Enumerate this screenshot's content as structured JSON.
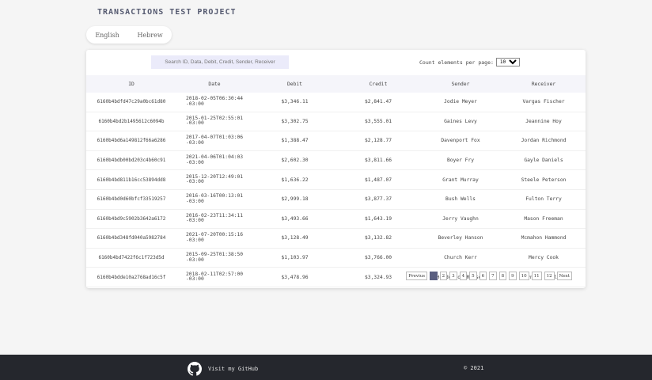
{
  "app": {
    "title": "TRANSACTIONS TEST PROJECT"
  },
  "languages": [
    {
      "label": "English",
      "active": true
    },
    {
      "label": "Hebrew",
      "active": false
    }
  ],
  "controls": {
    "search_placeholder": "Search ID, Data, Debit, Credit, Sender, Receiver",
    "count_label": "Count elements per page:",
    "count_value": "10"
  },
  "table": {
    "headers": [
      "ID",
      "Date",
      "Debit",
      "Credit",
      "Sender",
      "Receiver"
    ],
    "rows": [
      {
        "id": "6160b4bdfd47c29a0bc61d80",
        "date": "2018-02-05T06:30:44 -03:00",
        "debit": "$3,346.11",
        "credit": "$2,841.47",
        "sender": "Jodie Meyer",
        "receiver": "Vargas Fischer"
      },
      {
        "id": "6160b4bd2b1495612c6094b",
        "date": "2015-01-25T02:55:01 -03:00",
        "debit": "$3,302.75",
        "credit": "$3,555.01",
        "sender": "Gaines Levy",
        "receiver": "Jeannine Hoy"
      },
      {
        "id": "6160b4bd6a149812f66a6286",
        "date": "2017-04-07T01:03:06 -03:00",
        "debit": "$1,388.47",
        "credit": "$2,128.77",
        "sender": "Davenport Fox",
        "receiver": "Jordan Richmond"
      },
      {
        "id": "6160b4bdb00bd203c4b60c91",
        "date": "2021-04-06T01:04:03 -03:00",
        "debit": "$2,602.30",
        "credit": "$3,811.66",
        "sender": "Boyer Fry",
        "receiver": "Gayle Daniels"
      },
      {
        "id": "6160b4bd811b16cc53894dd8",
        "date": "2015-12-20T12:49:01 -03:00",
        "debit": "$1,636.22",
        "credit": "$1,487.07",
        "sender": "Grant Murray",
        "receiver": "Steele Peterson"
      },
      {
        "id": "6160b4bd0d60bfcf33519257",
        "date": "2016-03-16T00:13:01 -03:00",
        "debit": "$2,999.18",
        "credit": "$3,877.37",
        "sender": "Bush Wells",
        "receiver": "Fulton Terry"
      },
      {
        "id": "6160b4bd9c5902b3642a6172",
        "date": "2016-02-23T11:34:11 -03:00",
        "debit": "$3,493.66",
        "credit": "$1,643.19",
        "sender": "Jerry Vaughn",
        "receiver": "Mason Freeman"
      },
      {
        "id": "6160b4bd348fd040a5982784",
        "date": "2021-07-20T00:15:16 -03:00",
        "debit": "$3,128.49",
        "credit": "$3,132.82",
        "sender": "Beverley Hanson",
        "receiver": "Mcmahon Hammond"
      },
      {
        "id": "6160b4bd7422f6c1f723d5d",
        "date": "2015-09-25T01:38:50 -03:00",
        "debit": "$1,103.97",
        "credit": "$3,766.00",
        "sender": "Church Kerr",
        "receiver": "Mercy Cook"
      },
      {
        "id": "6160b4bdde10a2768ad16c5f",
        "date": "2018-02-11T02:57:00 -03:00",
        "debit": "$3,478.96",
        "credit": "$3,324.93",
        "sender": "Henderson Ramsey",
        "receiver": "Maynard Mcclain"
      }
    ]
  },
  "pagination": {
    "prev_label": "Previus",
    "next_label": "Next",
    "pages": [
      "1",
      "2",
      "3",
      "4",
      "5",
      "6",
      "7",
      "8",
      "9",
      "10",
      "11",
      "12"
    ],
    "current": "1"
  },
  "footer": {
    "github_label": "Visit my GitHub",
    "copyright": "© 2021",
    "icon": "github-icon"
  },
  "colors": {
    "accent": "#5a5f80",
    "footer_bg": "#25272d",
    "search_bg": "#ebebfa"
  }
}
